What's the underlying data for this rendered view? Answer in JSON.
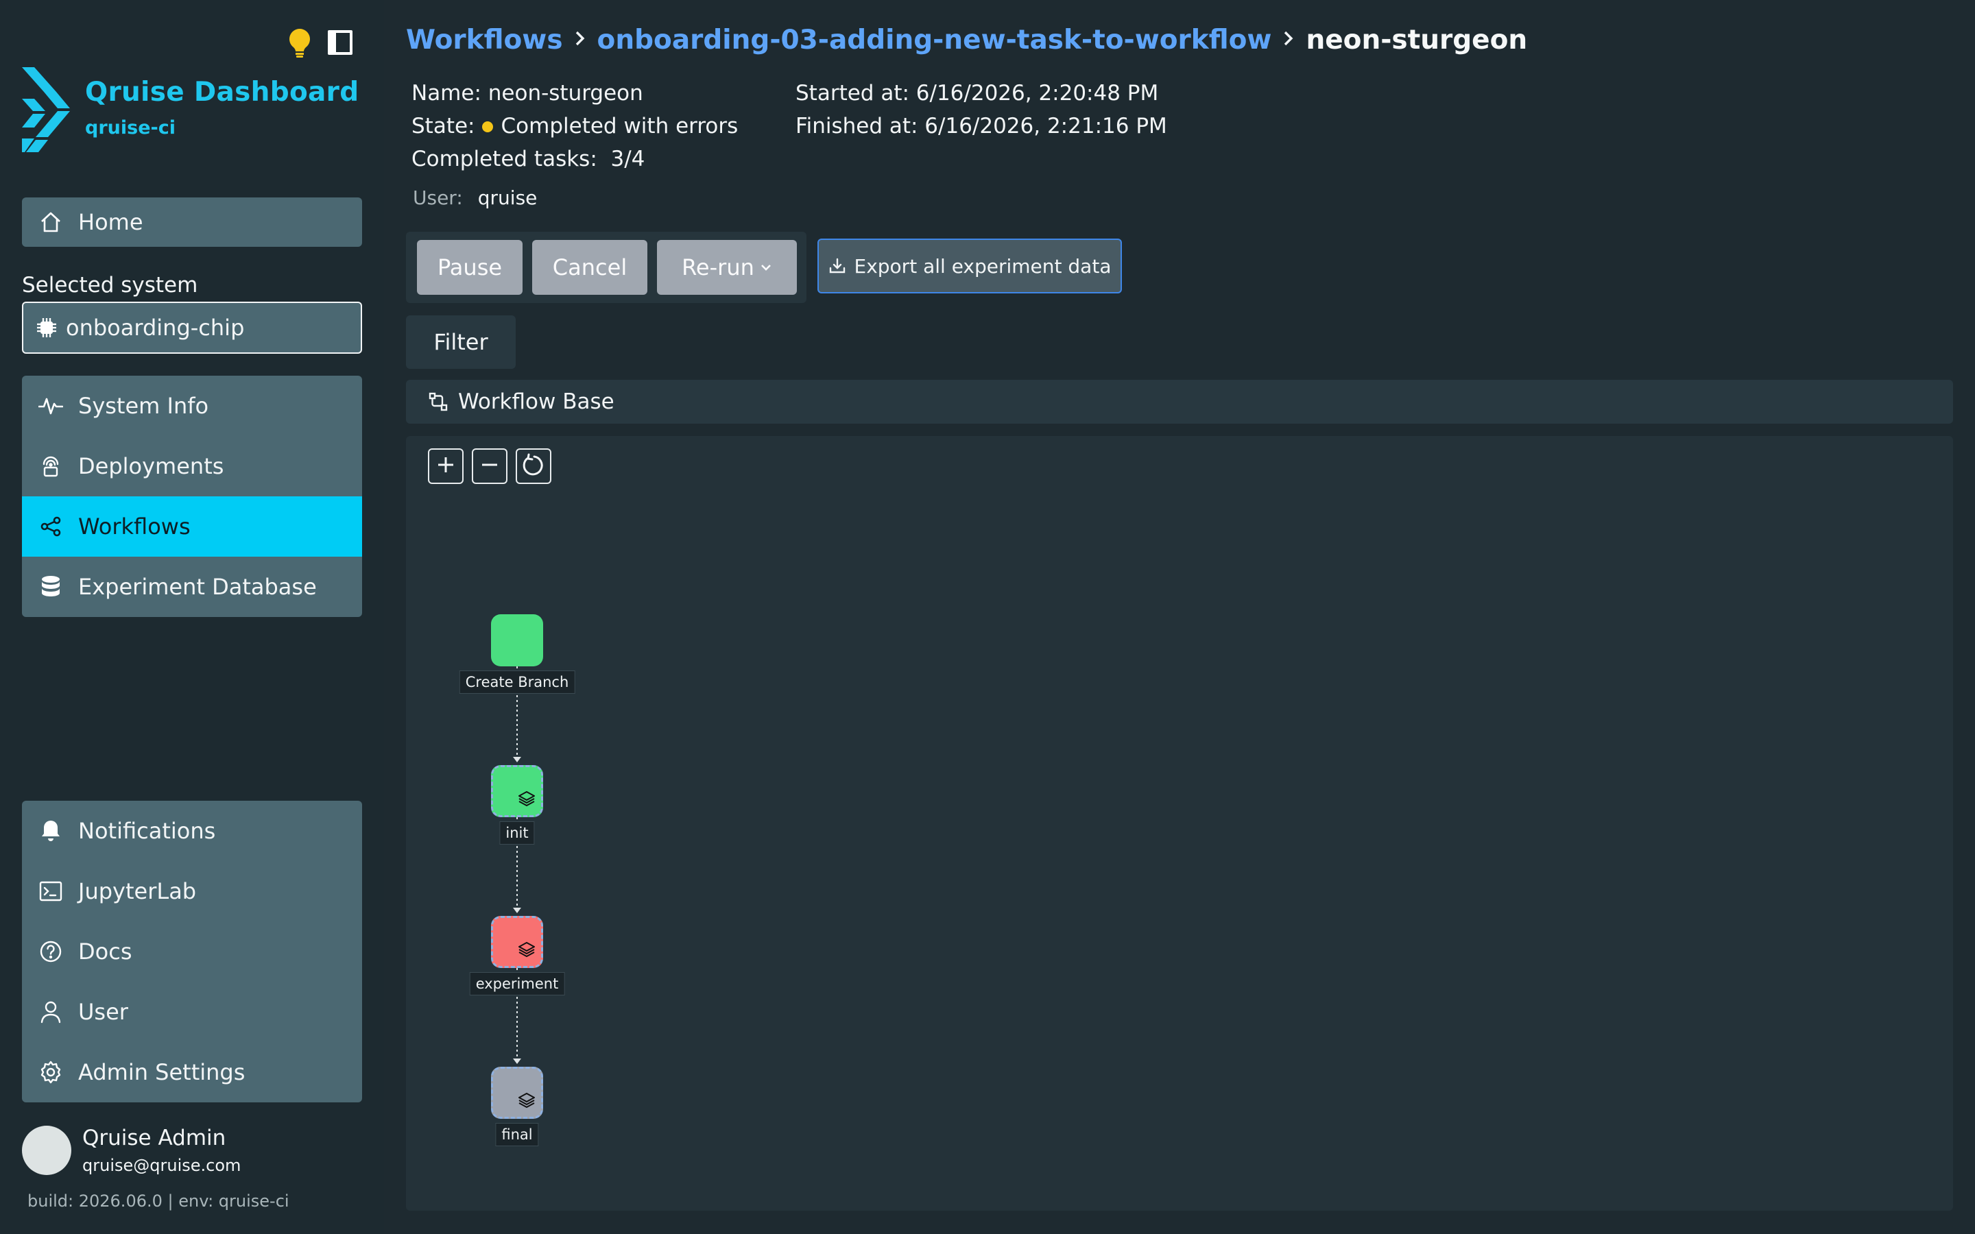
{
  "app": {
    "title": "Qruise Dashboard",
    "subtitle": "qruise-ci"
  },
  "sidebar": {
    "home_label": "Home",
    "selected_system_label": "Selected system",
    "selected_system_value": "onboarding-chip",
    "main_items": [
      {
        "label": "System Info",
        "icon": "activity-icon"
      },
      {
        "label": "Deployments",
        "icon": "broadcast-icon"
      },
      {
        "label": "Workflows",
        "icon": "share-nodes-icon",
        "active": true
      },
      {
        "label": "Experiment Database",
        "icon": "database-icon"
      }
    ],
    "bottom_items": [
      {
        "label": "Notifications",
        "icon": "bell-icon"
      },
      {
        "label": "JupyterLab",
        "icon": "terminal-icon"
      },
      {
        "label": "Docs",
        "icon": "help-circle-icon"
      },
      {
        "label": "User",
        "icon": "user-icon"
      },
      {
        "label": "Admin Settings",
        "icon": "gear-icon"
      }
    ]
  },
  "profile": {
    "name": "Qruise Admin",
    "email": "qruise@qruise.com"
  },
  "build_info": "build: 2026.06.0 | env: qruise-ci",
  "breadcrumb": {
    "root": "Workflows",
    "workflow": "onboarding-03-adding-new-task-to-workflow",
    "current": "neon-sturgeon"
  },
  "run": {
    "name_line": "Name: neon-sturgeon",
    "state_label": "State:",
    "state_value": "Completed with errors",
    "completed_tasks_label": "Completed tasks:",
    "completed_tasks_value": "3/4",
    "started_line": "Started at: 6/16/2026, 2:20:48 PM",
    "finished_line": "Finished at: 6/16/2026, 2:21:16 PM",
    "user_label": "User:",
    "user_value": "qruise",
    "state_color": "#f5c518"
  },
  "actions": {
    "pause": "Pause",
    "cancel": "Cancel",
    "rerun": "Re-run",
    "export": "Export all experiment data",
    "filter": "Filter"
  },
  "workflow": {
    "section_title": "Workflow Base",
    "nodes": [
      {
        "label": "Create Branch",
        "color": "#4ade80",
        "status": "success"
      },
      {
        "label": "init",
        "color": "#4ade80",
        "status": "success"
      },
      {
        "label": "experiment",
        "color": "#f87171",
        "status": "error"
      },
      {
        "label": "final",
        "color": "#9ca3af",
        "status": "pending"
      }
    ]
  }
}
